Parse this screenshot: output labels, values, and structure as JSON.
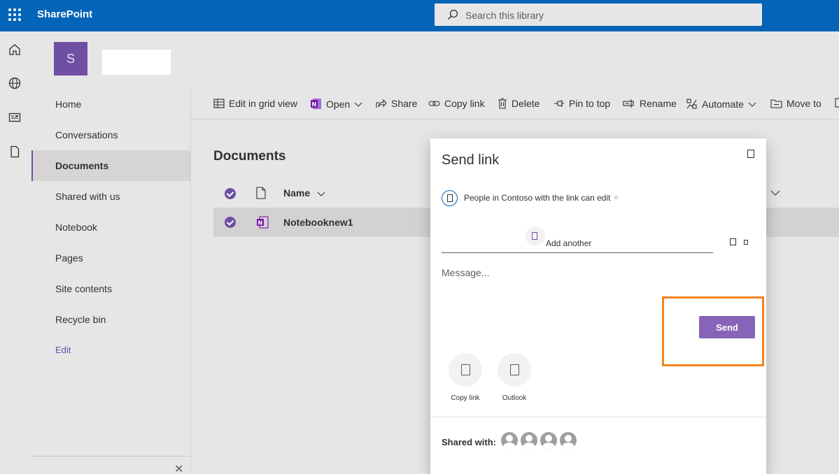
{
  "suite": {
    "app_name": "SharePoint",
    "search_placeholder": "Search this library"
  },
  "site": {
    "logo_letter": "S"
  },
  "nav": {
    "items": [
      "Home",
      "Conversations",
      "Documents",
      "Shared with us",
      "Notebook",
      "Pages",
      "Site contents",
      "Recycle bin"
    ],
    "active": "Documents",
    "edit_label": "Edit",
    "close_glyph": "✕"
  },
  "commandbar": {
    "edit_grid": "Edit in grid view",
    "open": "Open",
    "share": "Share",
    "copy_link": "Copy link",
    "delete": "Delete",
    "pin_to_top": "Pin to top",
    "rename": "Rename",
    "automate": "Automate",
    "move_to": "Move to"
  },
  "library": {
    "title": "Documents",
    "column_name": "Name",
    "rows": [
      {
        "name": "Notebooknew1",
        "selected": true
      }
    ]
  },
  "dialog": {
    "title": "Send link",
    "permission_text": "People in Contoso with the link can edit",
    "recipient_placeholder": "Add another",
    "message_placeholder": "Message...",
    "send_label": "Send",
    "share_options": [
      "Copy link",
      "Outlook"
    ],
    "shared_with_label": "Shared with:",
    "shared_avatar_count": 4
  },
  "colors": {
    "suitebar": "#0364b8",
    "brand_purple": "#6e4fa4",
    "send_button": "#8764b8",
    "highlight": "#f5821f"
  }
}
